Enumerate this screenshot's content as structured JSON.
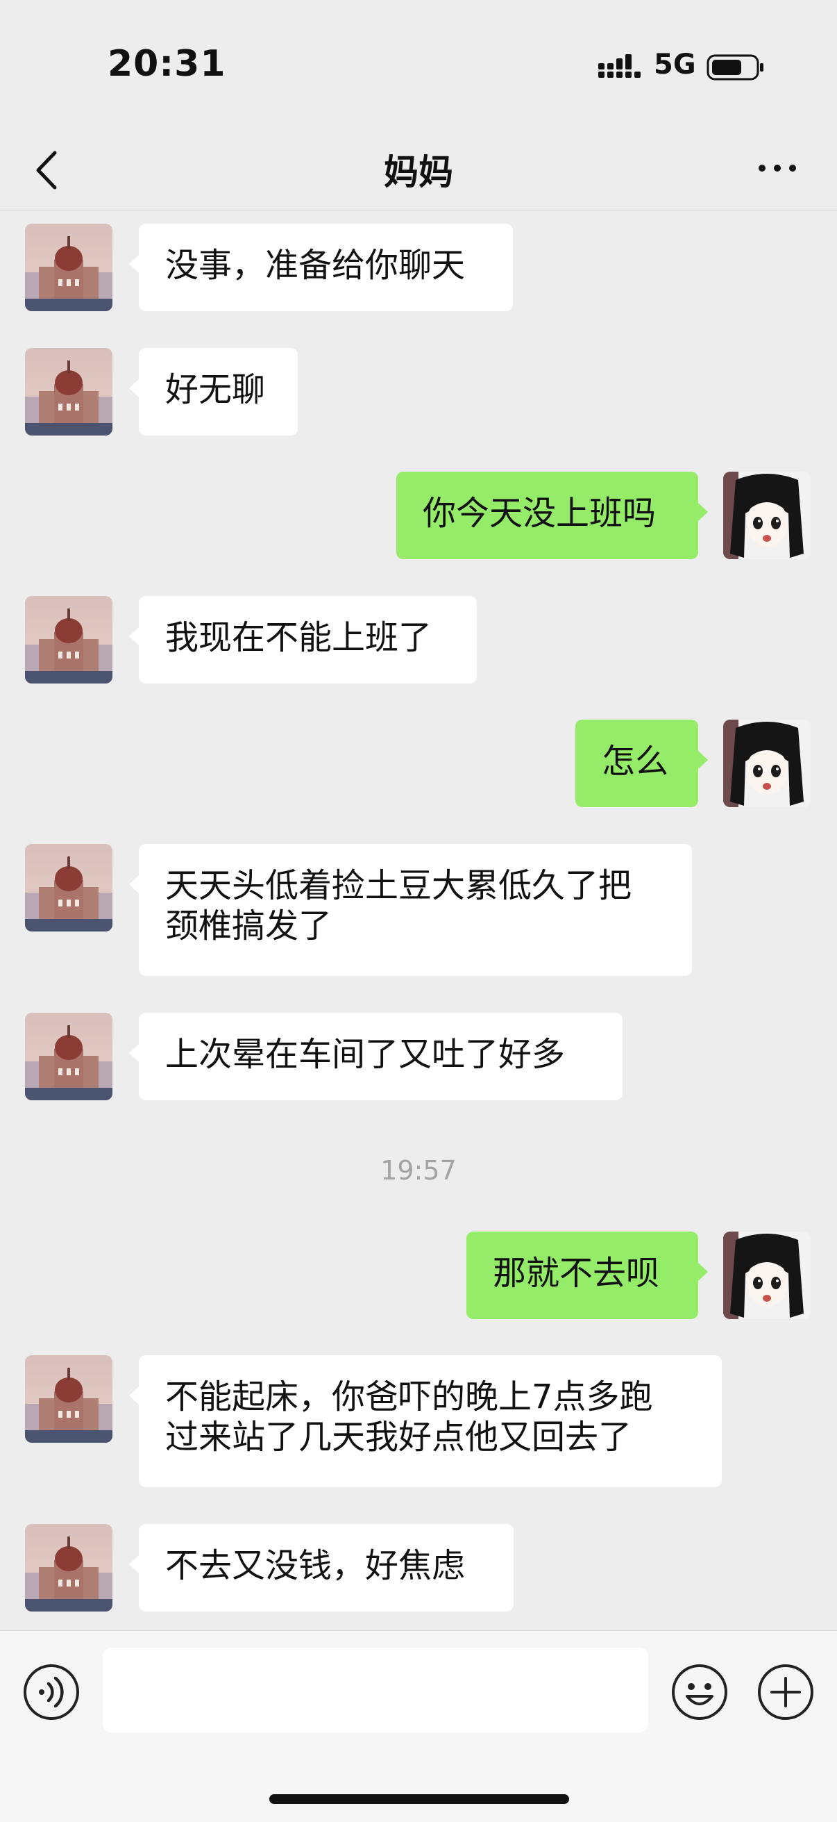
{
  "status_bar": {
    "time": "20:31",
    "network": "5G",
    "icons": [
      "signal-icon",
      "battery-icon"
    ]
  },
  "header": {
    "title": "妈妈",
    "back_icon": "chevron-left-icon",
    "more_icon": "more-horizontal-icon"
  },
  "messages": [
    {
      "from": "mom",
      "text": "没事，准备给你聊天"
    },
    {
      "from": "mom",
      "text": "好无聊"
    },
    {
      "from": "me",
      "text": "你今天没上班吗"
    },
    {
      "from": "mom",
      "text": "我现在不能上班了"
    },
    {
      "from": "me",
      "text": "怎么"
    },
    {
      "from": "mom",
      "text": "天天头低着捡土豆大累低久了把\n颈椎搞发了"
    },
    {
      "from": "mom",
      "text": "上次晕在车间了又吐了好多"
    },
    {
      "type": "timestamp",
      "text": "19:57"
    },
    {
      "from": "me",
      "text": "那就不去呗"
    },
    {
      "from": "mom",
      "text": "不能起床，你爸吓的晚上7点多跑\n过来站了几天我好点他又回去了"
    },
    {
      "from": "mom",
      "text": "不去又没钱，好焦虑"
    }
  ],
  "input_bar": {
    "value": "",
    "icons": [
      "voice-icon",
      "emoji-icon",
      "plus-circle-icon"
    ]
  },
  "colors": {
    "background": "#ededed",
    "incoming_bubble": "#ffffff",
    "outgoing_bubble": "#95ec69",
    "timestamp": "#a3a3a3"
  }
}
